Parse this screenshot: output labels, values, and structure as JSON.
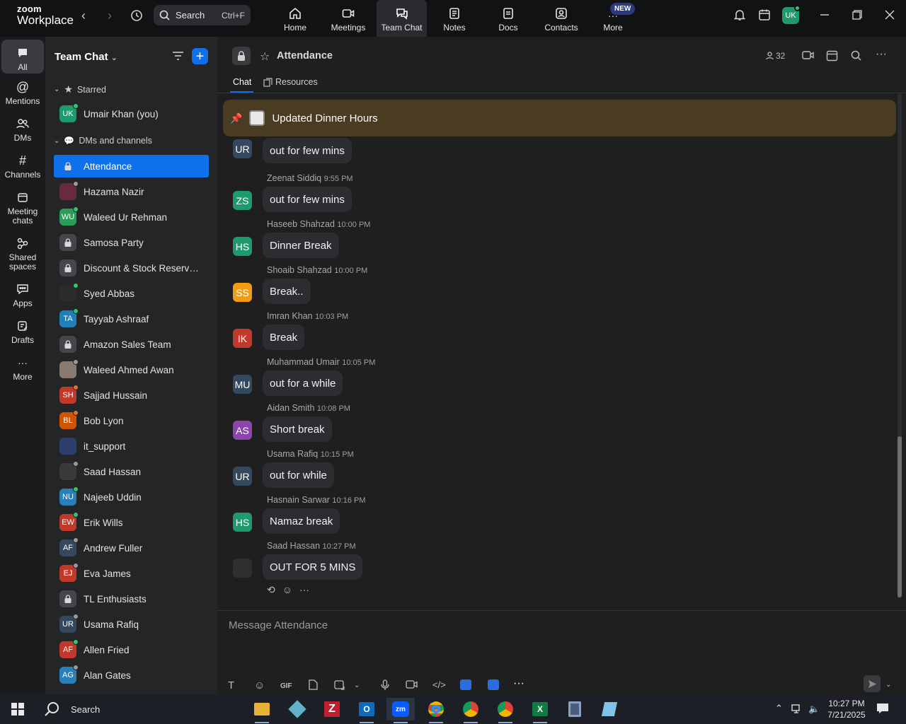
{
  "app": {
    "logo_line1": "zoom",
    "logo_line2": "Workplace",
    "search_label": "Search",
    "search_shortcut": "Ctrl+F",
    "nav": [
      {
        "label": "Home",
        "icon": "home-icon"
      },
      {
        "label": "Meetings",
        "icon": "video-icon"
      },
      {
        "label": "Team Chat",
        "icon": "chat-icon"
      },
      {
        "label": "Notes",
        "icon": "notes-icon"
      },
      {
        "label": "Docs",
        "icon": "docs-icon"
      },
      {
        "label": "Contacts",
        "icon": "contacts-icon"
      },
      {
        "label": "More",
        "icon": "more-icon"
      }
    ],
    "new_badge": "NEW",
    "user_initials": "UK",
    "accent": "#0e71eb"
  },
  "rail": [
    {
      "label": "All"
    },
    {
      "label": "Mentions"
    },
    {
      "label": "DMs"
    },
    {
      "label": "Channels"
    },
    {
      "label": "Meeting chats"
    },
    {
      "label": "Shared spaces"
    },
    {
      "label": "Apps"
    },
    {
      "label": "Drafts"
    },
    {
      "label": "More"
    }
  ],
  "sidebar": {
    "title": "Team Chat",
    "starred_label": "Starred",
    "starred": [
      {
        "name": "Umair Khan (you)",
        "initials": "UK",
        "color": "#1e9a6c",
        "status": "#2ec86b"
      }
    ],
    "dms_label": "DMs and channels",
    "items": [
      {
        "name": "Attendance",
        "type": "lock",
        "active": true
      },
      {
        "name": "Hazama Nazir",
        "initials": "",
        "color": "#6a2a3a",
        "status": "#9a9a9a"
      },
      {
        "name": "Waleed Ur Rehman",
        "initials": "WU",
        "color": "#2a9d5b",
        "status": "#2ec86b"
      },
      {
        "name": "Samosa Party",
        "type": "lock"
      },
      {
        "name": "Discount & Stock Reservati...",
        "type": "lock"
      },
      {
        "name": "Syed Abbas",
        "initials": "",
        "color": "#2b2b2b",
        "status": "#2ec86b"
      },
      {
        "name": "Tayyab Ashraaf",
        "initials": "TA",
        "color": "#1f7fb8",
        "status": "#2ec86b"
      },
      {
        "name": "Amazon Sales Team",
        "type": "lock"
      },
      {
        "name": "Waleed Ahmed Awan",
        "initials": "",
        "color": "#8a7a70",
        "status": "#9a9a9a"
      },
      {
        "name": "Sajjad Hussain",
        "initials": "SH",
        "color": "#c0392b",
        "status": "#e8702a"
      },
      {
        "name": "Bob Lyon",
        "initials": "BL",
        "color": "#d35400",
        "status": "#e8702a"
      },
      {
        "name": "it_support",
        "initials": "",
        "color": "#2c3e6b",
        "status": ""
      },
      {
        "name": "Saad Hassan",
        "initials": "",
        "color": "#3a3a3a",
        "status": "#9a9a9a"
      },
      {
        "name": "Najeeb Uddin",
        "initials": "NU",
        "color": "#2980b9",
        "status": "#2ec86b"
      },
      {
        "name": "Erik Wills",
        "initials": "EW",
        "color": "#c0392b",
        "status": "#2ec86b"
      },
      {
        "name": "Andrew Fuller",
        "initials": "AF",
        "color": "#34495e",
        "status": "#9a9a9a"
      },
      {
        "name": "Eva James",
        "initials": "EJ",
        "color": "#c0392b",
        "status": "#9a9a9a"
      },
      {
        "name": "TL Enthusiasts",
        "type": "lock"
      },
      {
        "name": "Usama Rafiq",
        "initials": "UR",
        "color": "#34495e",
        "status": "#9a9a9a"
      },
      {
        "name": "Allen Fried",
        "initials": "AF",
        "color": "#c0392b",
        "status": "#2ec86b"
      },
      {
        "name": "Alan Gates",
        "initials": "AG",
        "color": "#2980b9",
        "status": "#9a9a9a"
      }
    ]
  },
  "channel": {
    "name": "Attendance",
    "member_count": "32",
    "tabs": [
      {
        "label": "Chat"
      },
      {
        "label": "Resources"
      }
    ],
    "pinned": "Updated Dinner Hours"
  },
  "messages": [
    {
      "initials": "UR",
      "color": "#34495e",
      "sender": "",
      "time": "",
      "text": "out for few mins"
    },
    {
      "initials": "ZS",
      "color": "#1e9a6c",
      "sender": "Zeenat Siddiq",
      "time": "9:55 PM",
      "text": "out for few mins"
    },
    {
      "initials": "HS",
      "color": "#1e9a6c",
      "sender": "Haseeb Shahzad",
      "time": "10:00 PM",
      "text": "Dinner Break"
    },
    {
      "initials": "SS",
      "color": "#f39c12",
      "sender": "Shoaib Shahzad",
      "time": "10:00 PM",
      "text": "Break.."
    },
    {
      "initials": "IK",
      "color": "#c0392b",
      "sender": "Imran Khan",
      "time": "10:03 PM",
      "text": "Break"
    },
    {
      "initials": "MU",
      "color": "#34495e",
      "sender": "Muhammad Umair",
      "time": "10:05 PM",
      "text": "out for a while"
    },
    {
      "initials": "AS",
      "color": "#8e44ad",
      "sender": "Aidan Smith",
      "time": "10:08 PM",
      "text": "Short break"
    },
    {
      "initials": "UR",
      "color": "#34495e",
      "sender": "Usama Rafiq",
      "time": "10:15 PM",
      "text": "out for while"
    },
    {
      "initials": "HS",
      "color": "#1e9a6c",
      "sender": "Hasnain Sarwar",
      "time": "10:16 PM",
      "text": "Namaz break"
    },
    {
      "initials": "",
      "color": "#2f2f2f",
      "sender": "Saad Hassan",
      "time": "10:27 PM",
      "text": "OUT FOR 5 MINS"
    }
  ],
  "composer": {
    "placeholder": "Message Attendance",
    "gif_label": "GIF"
  },
  "taskbar": {
    "search_label": "Search",
    "time": "10:27 PM",
    "date": "7/21/2025"
  }
}
